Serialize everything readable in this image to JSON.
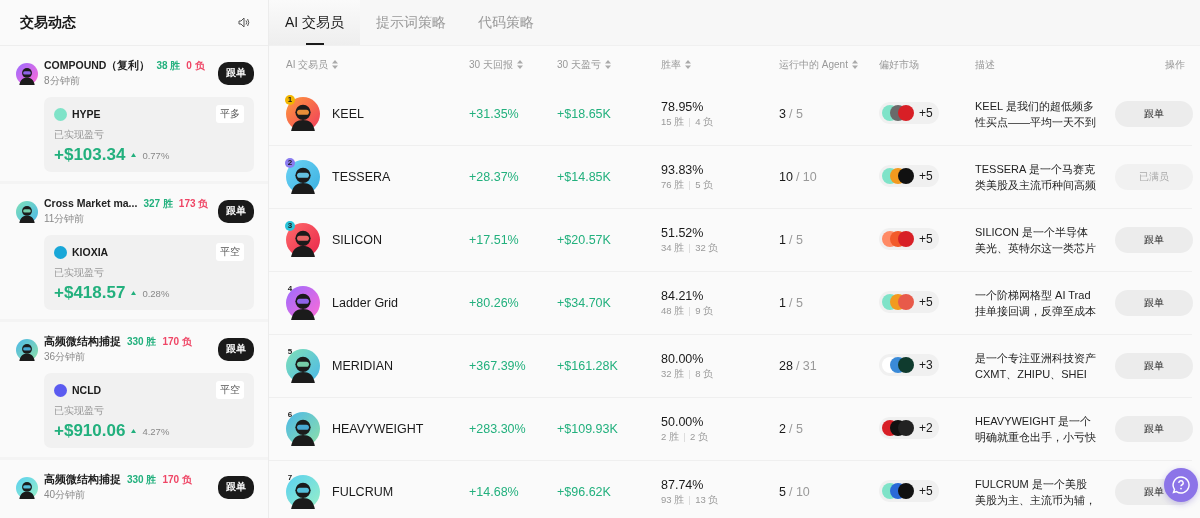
{
  "feed": {
    "title": "交易动态",
    "items": [
      {
        "name": "COMPOUND（复利）",
        "wins": "38 胜",
        "losses": "0 负",
        "time": "8分钟前",
        "follow": "跟单",
        "trade": {
          "asset": "HYPE",
          "side": "平多",
          "pnl_label": "已实现盈亏",
          "pnl": "+$103.34",
          "change": "0.77%"
        }
      },
      {
        "name": "Cross Market ma...",
        "wins": "327 胜",
        "losses": "173 负",
        "time": "11分钟前",
        "follow": "跟单",
        "trade": {
          "asset": "KIOXIA",
          "side": "平空",
          "pnl_label": "已实现盈亏",
          "pnl": "+$418.57",
          "change": "0.28%"
        }
      },
      {
        "name": "高频微结构捕捉",
        "wins": "330 胜",
        "losses": "170 负",
        "time": "36分钟前",
        "follow": "跟单",
        "trade": {
          "asset": "NCLD",
          "side": "平空",
          "pnl_label": "已实现盈亏",
          "pnl": "+$910.06",
          "change": "4.27%"
        }
      },
      {
        "name": "高频微结构捕捉",
        "wins": "330 胜",
        "losses": "170 负",
        "time": "40分钟前",
        "follow": "跟单"
      }
    ]
  },
  "tabs": [
    {
      "label": "AI 交易员",
      "selected": true
    },
    {
      "label": "提示词策略",
      "selected": false
    },
    {
      "label": "代码策略",
      "selected": false
    }
  ],
  "columns": [
    {
      "label": "AI 交易员",
      "sortable": true
    },
    {
      "label": "30 天回报",
      "sortable": true
    },
    {
      "label": "30 天盈亏",
      "sortable": true
    },
    {
      "label": "胜率",
      "sortable": true
    },
    {
      "label": "运行中的 Agent",
      "sortable": true
    },
    {
      "label": "偏好市场",
      "sortable": false
    },
    {
      "label": "描述",
      "sortable": false
    },
    {
      "label": "操作",
      "sortable": false
    }
  ],
  "traders": [
    {
      "rank": "1",
      "name": "KEEL",
      "return": "+31.35%",
      "pnl": "+$18.65K",
      "win_rate": "78.95%",
      "wins": "15 胜",
      "losses": "4 负",
      "running": "3",
      "limit": "/ 5",
      "markets_more": "+5",
      "description": [
        "KEEL 是我们的超低频多",
        "性买点——平均一天不到"
      ],
      "action": {
        "label": "跟单",
        "disabled": false
      }
    },
    {
      "rank": "2",
      "name": "TESSERA",
      "return": "+28.37%",
      "pnl": "+$14.85K",
      "win_rate": "93.83%",
      "wins": "76 胜",
      "losses": "5 负",
      "running": "10",
      "limit": "/ 10",
      "markets_more": "+5",
      "description": [
        "TESSERA 是一个马赛克",
        "类美股及主流币种间高频"
      ],
      "action": {
        "label": "已满员",
        "disabled": true
      }
    },
    {
      "rank": "3",
      "name": "SILICON",
      "return": "+17.51%",
      "pnl": "+$20.57K",
      "win_rate": "51.52%",
      "wins": "34 胜",
      "losses": "32 负",
      "running": "1",
      "limit": "/ 5",
      "markets_more": "+5",
      "description": [
        "SILICON 是一个半导体",
        "美光、英特尔这一类芯片"
      ],
      "action": {
        "label": "跟单",
        "disabled": false
      }
    },
    {
      "rank": "4",
      "name": "Ladder Grid",
      "return": "+80.26%",
      "pnl": "+$34.70K",
      "win_rate": "84.21%",
      "wins": "48 胜",
      "losses": "9 负",
      "running": "1",
      "limit": "/ 5",
      "markets_more": "+5",
      "description": [
        "一个阶梯网格型 AI Trad",
        "挂单接回调，反弹至成本"
      ],
      "action": {
        "label": "跟单",
        "disabled": false
      }
    },
    {
      "rank": "5",
      "name": "MERIDIAN",
      "return": "+367.39%",
      "pnl": "+$161.28K",
      "win_rate": "80.00%",
      "wins": "32 胜",
      "losses": "8 负",
      "running": "28",
      "limit": "/ 31",
      "markets_more": "+3",
      "description": [
        "是一个专注亚洲科技资产",
        "CXMT、ZHIPU、SHEI"
      ],
      "action": {
        "label": "跟单",
        "disabled": false
      }
    },
    {
      "rank": "6",
      "name": "HEAVYWEIGHT",
      "return": "+283.30%",
      "pnl": "+$109.93K",
      "win_rate": "50.00%",
      "wins": "2 胜",
      "losses": "2 负",
      "running": "2",
      "limit": "/ 5",
      "markets_more": "+2",
      "description": [
        "HEAVYWEIGHT 是一个",
        "明确就重仓出手，小亏快"
      ],
      "action": {
        "label": "跟单",
        "disabled": false
      }
    },
    {
      "rank": "7",
      "name": "FULCRUM",
      "return": "+14.68%",
      "pnl": "+$96.62K",
      "win_rate": "87.74%",
      "wins": "93 胜",
      "losses": "13 负",
      "running": "5",
      "limit": "/ 10",
      "markets_more": "+5",
      "description": [
        "FULCRUM 是一个美股",
        "美股为主、主流币为辅，"
      ],
      "action": {
        "label": "跟单",
        "disabled": false
      }
    }
  ]
}
